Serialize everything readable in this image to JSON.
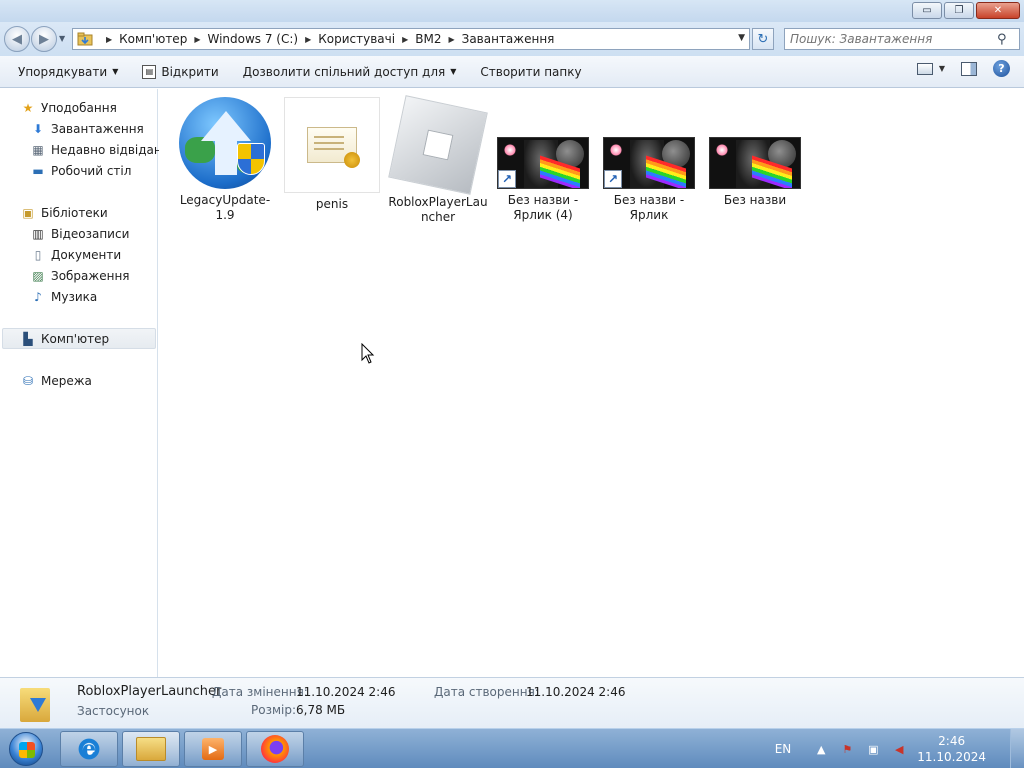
{
  "window": {
    "minimize_label": "▭",
    "maximize_label": "❐",
    "close_label": "✕"
  },
  "address": {
    "breadcrumbs": [
      "Комп'ютер",
      "Windows 7 (C:)",
      "Користувачі",
      "BM2",
      "Завантаження"
    ],
    "search_placeholder": "Пошук: Завантаження"
  },
  "toolbar": {
    "organize": "Упорядкувати",
    "open": "Відкрити",
    "share": "Дозволити спільний доступ для",
    "new_folder": "Створити папку"
  },
  "sidebar": {
    "favorites": "Уподобання",
    "downloads": "Завантаження",
    "recent": "Недавно відвідане",
    "desktop": "Робочий стіл",
    "libraries": "Бібліотеки",
    "videos": "Відеозаписи",
    "documents": "Документи",
    "pictures": "Зображення",
    "music": "Музика",
    "computer": "Комп'ютер",
    "network": "Мережа"
  },
  "files": [
    {
      "name": "LegacyUpdate-1.9",
      "icon": "legacy-update-icon"
    },
    {
      "name": "penis",
      "icon": "certificate-icon"
    },
    {
      "name": "RobloxPlayerLauncher",
      "icon": "roblox-icon"
    },
    {
      "name": "Без назви - Ярлик (4)",
      "icon": "image-shortcut"
    },
    {
      "name": "Без назви - Ярлик",
      "icon": "image-shortcut"
    },
    {
      "name": "Без назви",
      "icon": "image-thumbnail"
    }
  ],
  "details": {
    "name": "RobloxPlayerLauncher",
    "type": "Застосунок",
    "modified_label": "Дата змінення:",
    "modified_value": "11.10.2024 2:46",
    "created_label": "Дата створення:",
    "created_value": "11.10.2024 2:46",
    "size_label": "Розмір:",
    "size_value": "6,78 МБ"
  },
  "taskbar": {
    "lang": "EN",
    "time": "2:46",
    "date": "11.10.2024"
  }
}
